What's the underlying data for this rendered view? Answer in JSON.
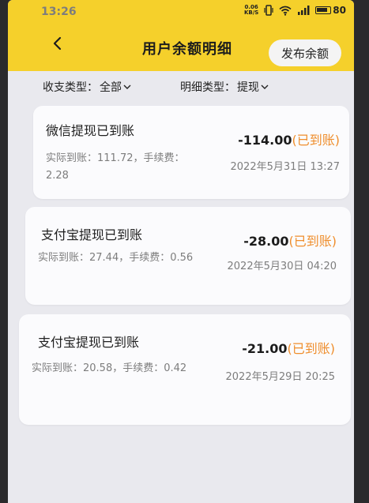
{
  "status_bar": {
    "time": "13:26",
    "speed_value": "0.06",
    "speed_unit": "KB/S",
    "battery": "80"
  },
  "header": {
    "title": "用户余额明细",
    "publish_button": "发布余额",
    "back_icon": "chevron-left-icon",
    "accent_color": "#f5d02b"
  },
  "filters": {
    "income_expense_label": "收支类型：",
    "income_expense_value": "全部",
    "detail_type_label": "明细类型：",
    "detail_type_value": "提现"
  },
  "records": [
    {
      "title": "微信提现已到账",
      "amount": "-114.00",
      "status": "(已到账)",
      "desc": "实际到账：111.72，手续费：2.28",
      "time": "2022年5月31日 13:27"
    },
    {
      "title": "支付宝提现已到账",
      "amount": "-28.00",
      "status": "(已到账)",
      "desc": "实际到账：27.44，手续费：0.56",
      "time": "2022年5月30日 04:20"
    },
    {
      "title": "支付宝提现已到账",
      "amount": "-21.00",
      "status": "(已到账)",
      "desc": "实际到账：20.58，手续费：0.42",
      "time": "2022年5月29日 20:25"
    }
  ],
  "colors": {
    "status_tag": "#ef8e2d",
    "background": "#e9e9ee"
  }
}
